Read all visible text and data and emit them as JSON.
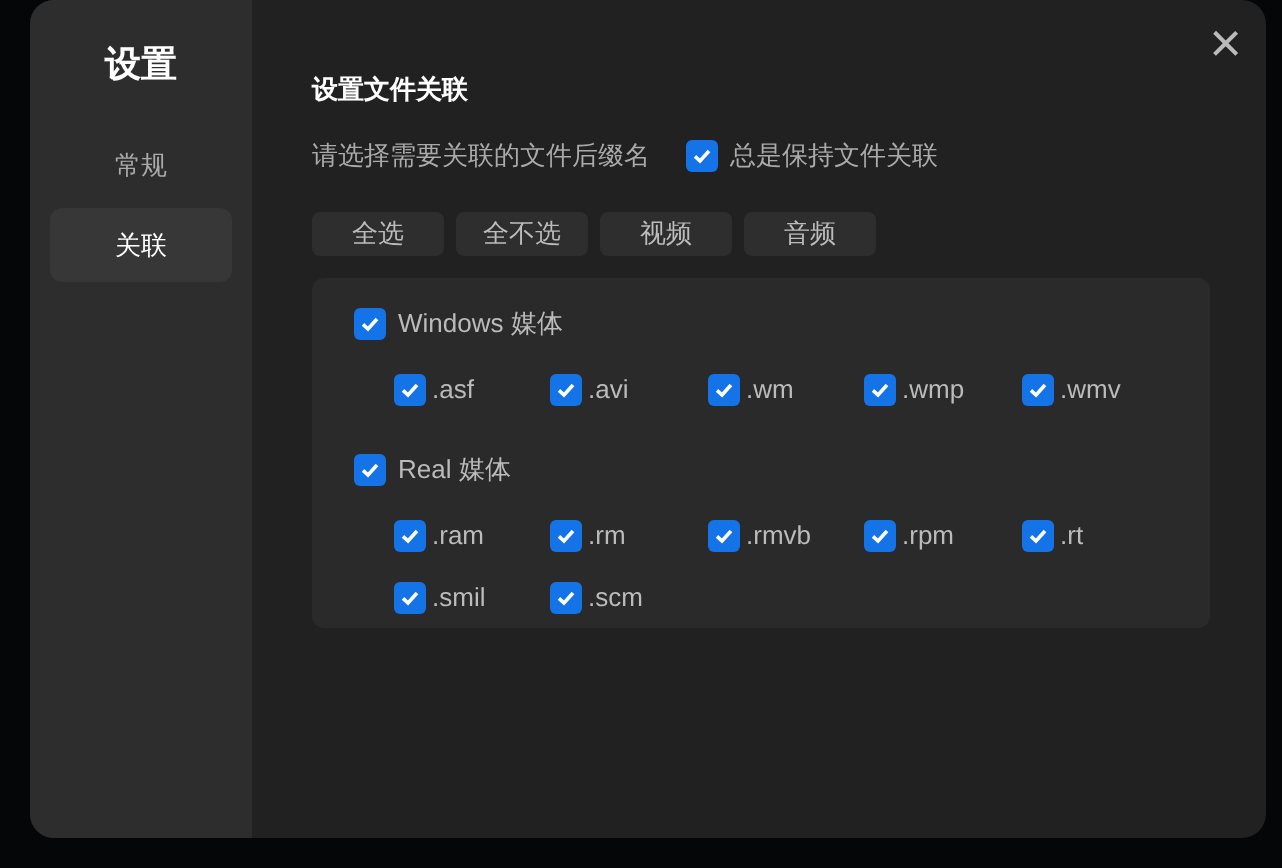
{
  "sidebar": {
    "title": "设置",
    "items": [
      {
        "label": "常规",
        "selected": false
      },
      {
        "label": "关联",
        "selected": true
      }
    ]
  },
  "close": "×",
  "section_title": "设置文件关联",
  "prompt": "请选择需要关联的文件后缀名",
  "always_keep": {
    "label": "总是保持文件关联",
    "checked": true
  },
  "buttons": [
    "全选",
    "全不选",
    "视频",
    "音频"
  ],
  "groups": [
    {
      "label": "Windows 媒体",
      "checked": true,
      "extensions": [
        {
          "label": ".asf",
          "checked": true
        },
        {
          "label": ".avi",
          "checked": true
        },
        {
          "label": ".wm",
          "checked": true
        },
        {
          "label": ".wmp",
          "checked": true
        },
        {
          "label": ".wmv",
          "checked": true
        }
      ]
    },
    {
      "label": "Real 媒体",
      "checked": true,
      "extensions": [
        {
          "label": ".ram",
          "checked": true
        },
        {
          "label": ".rm",
          "checked": true
        },
        {
          "label": ".rmvb",
          "checked": true
        },
        {
          "label": ".rpm",
          "checked": true
        },
        {
          "label": ".rt",
          "checked": true
        },
        {
          "label": ".smil",
          "checked": true
        },
        {
          "label": ".scm",
          "checked": true
        }
      ]
    }
  ]
}
